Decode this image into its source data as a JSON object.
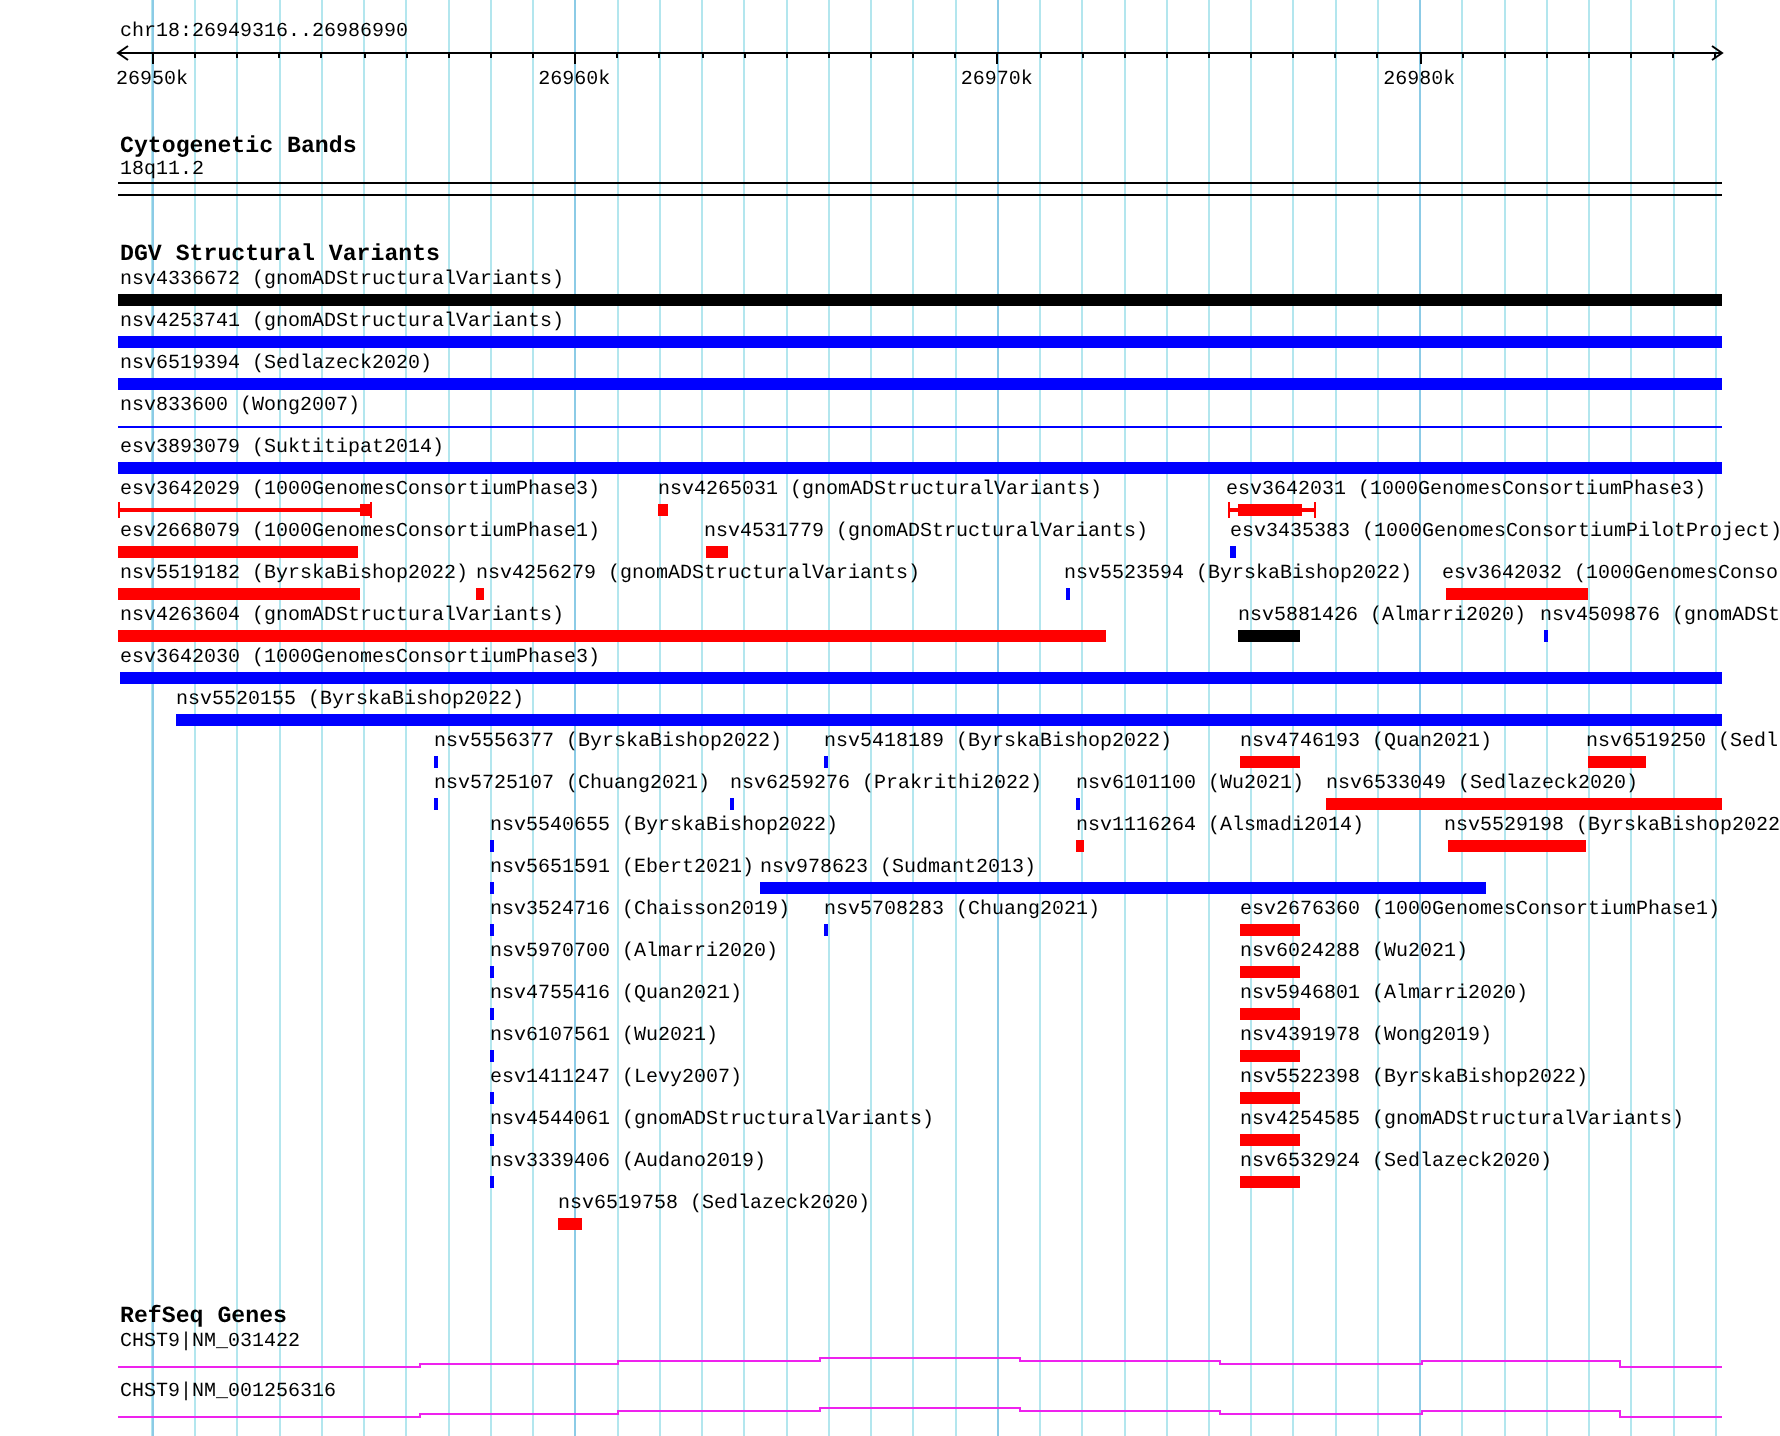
{
  "location": "chr18:26949316..26986990",
  "ruler": {
    "ticks": [
      "26950k",
      "26960k",
      "26970k",
      "26980k"
    ]
  },
  "cytoband_track": {
    "title": "Cytogenetic Bands",
    "band": "18q11.2"
  },
  "dgv_track": {
    "title": "DGV Structural Variants",
    "rows": [
      [
        {
          "label": "nsv4336672 (gnomADStructuralVariants)",
          "color": "#000000",
          "kind": "bar"
        }
      ],
      [
        {
          "label": "nsv4253741 (gnomADStructuralVariants)",
          "color": "#0000ff",
          "kind": "bar"
        }
      ],
      [
        {
          "label": "nsv6519394 (Sedlazeck2020)",
          "color": "#0000ff",
          "kind": "bar"
        }
      ],
      [
        {
          "label": "nsv833600 (Wong2007)",
          "color": "#0000ff",
          "kind": "line"
        }
      ],
      [
        {
          "label": "esv3893079 (Suktitipat2014)",
          "color": "#0000ff",
          "kind": "bar"
        }
      ],
      [
        {
          "label": "esv3642029 (1000GenomesConsortiumPhase3)",
          "color": "#ff0000",
          "kind": "bracketed"
        },
        {
          "label": "nsv4265031 (gnomADStructuralVariants)",
          "color": "#ff0000",
          "kind": "bar"
        },
        {
          "label": "esv3642031 (1000GenomesConsortiumPhase3)",
          "color": "#ff0000",
          "kind": "bracketed"
        }
      ],
      [
        {
          "label": "esv2668079 (1000GenomesConsortiumPhase1)",
          "color": "#ff0000",
          "kind": "bar"
        },
        {
          "label": "nsv4531779 (gnomADStructuralVariants)",
          "color": "#ff0000",
          "kind": "bar"
        },
        {
          "label": "esv3435383 (1000GenomesConsortiumPilotProject)",
          "color": "#0000ff",
          "kind": "bar"
        }
      ],
      [
        {
          "label": "nsv5519182 (ByrskaBishop2022)",
          "color": "#ff0000",
          "kind": "bar"
        },
        {
          "label": "nsv4256279 (gnomADStructuralVariants)",
          "color": "#ff0000",
          "kind": "bar"
        },
        {
          "label": "nsv5523594 (ByrskaBishop2022)",
          "color": "#0000ff",
          "kind": "bar"
        },
        {
          "label": "esv3642032 (1000GenomesConso",
          "color": "#ff0000",
          "kind": "bar"
        }
      ],
      [
        {
          "label": "nsv4263604 (gnomADStructuralVariants)",
          "color": "#ff0000",
          "kind": "bar"
        },
        {
          "label": "nsv5881426 (Almarri2020)",
          "color": "#000000",
          "kind": "bar"
        },
        {
          "label": "nsv4509876 (gnomADSt",
          "color": "#0000ff",
          "kind": "bar"
        }
      ],
      [
        {
          "label": "esv3642030 (1000GenomesConsortiumPhase3)",
          "color": "#0000ff",
          "kind": "bar"
        }
      ],
      [
        {
          "label": "nsv5520155 (ByrskaBishop2022)",
          "color": "#0000ff",
          "kind": "bar"
        }
      ],
      [
        {
          "label": "nsv5556377 (ByrskaBishop2022)",
          "color": "#0000ff",
          "kind": "bar"
        },
        {
          "label": "nsv5418189 (ByrskaBishop2022)",
          "color": "#0000ff",
          "kind": "bar"
        },
        {
          "label": "nsv4746193 (Quan2021)",
          "color": "#ff0000",
          "kind": "bar"
        },
        {
          "label": "nsv6519250 (Sedl",
          "color": "#ff0000",
          "kind": "bar"
        }
      ],
      [
        {
          "label": "nsv5725107 (Chuang2021)",
          "color": "#0000ff",
          "kind": "bar"
        },
        {
          "label": "nsv6259276 (Prakrithi2022)",
          "color": "#0000ff",
          "kind": "bar"
        },
        {
          "label": "nsv6101100 (Wu2021)",
          "color": "#0000ff",
          "kind": "bar"
        },
        {
          "label": "nsv6533049 (Sedlazeck2020)",
          "color": "#ff0000",
          "kind": "bar"
        }
      ],
      [
        {
          "label": "nsv5540655 (ByrskaBishop2022)",
          "color": "#0000ff",
          "kind": "bar"
        },
        {
          "label": "nsv1116264 (Alsmadi2014)",
          "color": "#ff0000",
          "kind": "bar"
        },
        {
          "label": "nsv5529198 (ByrskaBishop2022",
          "color": "#ff0000",
          "kind": "bar"
        }
      ],
      [
        {
          "label": "nsv5651591 (Ebert2021)",
          "color": "#0000ff",
          "kind": "bar"
        },
        {
          "label": "nsv978623 (Sudmant2013)",
          "color": "#0000ff",
          "kind": "bar"
        }
      ],
      [
        {
          "label": "nsv3524716 (Chaisson2019)",
          "color": "#0000ff",
          "kind": "bar"
        },
        {
          "label": "nsv5708283 (Chuang2021)",
          "color": "#0000ff",
          "kind": "bar"
        },
        {
          "label": "esv2676360 (1000GenomesConsortiumPhase1)",
          "color": "#ff0000",
          "kind": "bar"
        }
      ],
      [
        {
          "label": "nsv5970700 (Almarri2020)",
          "color": "#0000ff",
          "kind": "bar"
        },
        {
          "label": "nsv6024288 (Wu2021)",
          "color": "#ff0000",
          "kind": "bar"
        }
      ],
      [
        {
          "label": "nsv4755416 (Quan2021)",
          "color": "#0000ff",
          "kind": "bar"
        },
        {
          "label": "nsv5946801 (Almarri2020)",
          "color": "#ff0000",
          "kind": "bar"
        }
      ],
      [
        {
          "label": "nsv6107561 (Wu2021)",
          "color": "#0000ff",
          "kind": "bar"
        },
        {
          "label": "nsv4391978 (Wong2019)",
          "color": "#ff0000",
          "kind": "bar"
        }
      ],
      [
        {
          "label": "esv1411247 (Levy2007)",
          "color": "#0000ff",
          "kind": "bar"
        },
        {
          "label": "nsv5522398 (ByrskaBishop2022)",
          "color": "#ff0000",
          "kind": "bar"
        }
      ],
      [
        {
          "label": "nsv4544061 (gnomADStructuralVariants)",
          "color": "#0000ff",
          "kind": "bar"
        },
        {
          "label": "nsv4254585 (gnomADStructuralVariants)",
          "color": "#ff0000",
          "kind": "bar"
        }
      ],
      [
        {
          "label": "nsv3339406 (Audano2019)",
          "color": "#0000ff",
          "kind": "bar"
        },
        {
          "label": "nsv6532924 (Sedlazeck2020)",
          "color": "#ff0000",
          "kind": "bar"
        }
      ],
      [
        {
          "label": "nsv6519758 (Sedlazeck2020)",
          "color": "#ff0000",
          "kind": "bar"
        }
      ]
    ]
  },
  "refseq_track": {
    "title": "RefSeq Genes",
    "genes": [
      {
        "label": "CHST9|NM_031422"
      },
      {
        "label": "CHST9|NM_001256316"
      }
    ]
  }
}
